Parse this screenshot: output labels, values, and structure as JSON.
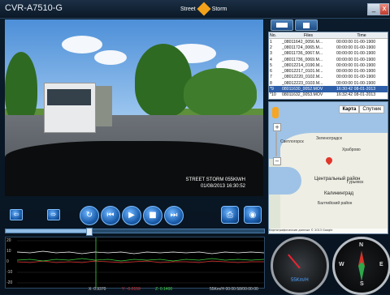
{
  "window": {
    "title": "CVR-A7510-G",
    "brand_left": "Street",
    "brand_right": "Storm"
  },
  "winbtns": {
    "minimize": "_",
    "close": "x"
  },
  "video": {
    "overlay_line1": "STREET STORM 055KM/H",
    "overlay_line2": "01/08/2013 16:30:52"
  },
  "files": {
    "headers": [
      "No.",
      "Files",
      "Time"
    ],
    "rows": [
      {
        "no": "1",
        "file": "_08011642_0056.M...",
        "time": "00:00:00 01-00-1900",
        "selected": false
      },
      {
        "no": "2",
        "file": "_08011724_0065.M...",
        "time": "00:00:00 01-00-1900",
        "selected": false
      },
      {
        "no": "3",
        "file": "_08011736_0067.M...",
        "time": "00:00:00 01-00-1900",
        "selected": false
      },
      {
        "no": "4",
        "file": "_08011736_0069.M...",
        "time": "00:00:00 01-00-1900",
        "selected": false
      },
      {
        "no": "5",
        "file": "_08012214_0190.M...",
        "time": "00:00:00 01-00-1900",
        "selected": false
      },
      {
        "no": "6",
        "file": "_08012217_0101.M...",
        "time": "00:00:00 01-00-1900",
        "selected": false
      },
      {
        "no": "7",
        "file": "_08012220_0102.M...",
        "time": "00:00:00 01-00-1900",
        "selected": false
      },
      {
        "no": "8",
        "file": "_08012223_0103.M...",
        "time": "00:00:00 01-00-1900",
        "selected": false
      },
      {
        "no": "*9",
        "file": "08011630_0052.MOV",
        "time": "16:30:42 08-01-2013",
        "selected": true
      },
      {
        "no": "*10",
        "file": "08011632_0053.MOV",
        "time": "16:32:42 08-01-2013",
        "selected": false
      },
      {
        "no": "*11",
        "file": "08011634_0054.MOV",
        "time": "16:34:42 08-01-2013",
        "selected": false
      }
    ]
  },
  "map": {
    "tab_map": "Карта",
    "tab_sat": "Спутник",
    "labels": {
      "zelenogradsk": "Зеленоградск",
      "svetlogorsk": "Светлогорск",
      "khrabrovo": "Храброво",
      "central": "Центральный район",
      "kaliningrad": "Калининград",
      "baltiysk": "Балтийский район",
      "gurievsk": "Гурьевск"
    },
    "footer": "Картографические данные © 2013 Google"
  },
  "controls": {
    "prev_small": "⇦",
    "next_small": "⇨",
    "loop": "↻",
    "rewind": "⏮",
    "play": "▶",
    "stop": "■",
    "forward": "⏭",
    "print": "⎙",
    "snapshot": "◉"
  },
  "seek": {
    "progress": 0.32
  },
  "graph": {
    "y_labels": [
      "-20",
      "-10",
      "0",
      "10",
      "20"
    ],
    "x_readout": "X: 0.9370",
    "y_readout": "Y: -0.0159",
    "z_readout": "Z: 0.1400",
    "speed_time": "55Km/H 00:00:58/00:00:00"
  },
  "speedometer": {
    "speed_text": "55Km/H"
  },
  "compass": {
    "n": "N",
    "s": "S",
    "e": "E",
    "w": "W"
  }
}
